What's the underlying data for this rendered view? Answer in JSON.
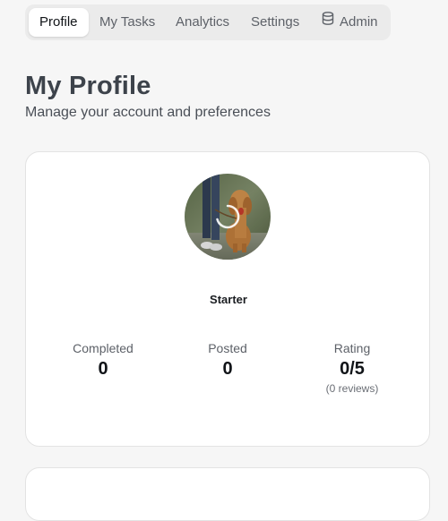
{
  "tabs": {
    "profile": "Profile",
    "tasks": "My Tasks",
    "analytics": "Analytics",
    "settings": "Settings",
    "admin": "Admin"
  },
  "header": {
    "title": "My Profile",
    "subtitle": "Manage your account and preferences"
  },
  "profile": {
    "tier": "Starter",
    "avatar_state": "loading",
    "stats": {
      "completed_label": "Completed",
      "completed_value": "0",
      "posted_label": "Posted",
      "posted_value": "0",
      "rating_label": "Rating",
      "rating_value": "0/5",
      "rating_note": "(0 reviews)"
    }
  },
  "colors": {
    "background": "#f6f6f6",
    "card": "#ffffff",
    "tab_bar": "#ebebeb",
    "text": "#1f2329"
  },
  "icons": {
    "admin": "database-icon",
    "avatar_overlay": "loading-spinner-icon"
  }
}
